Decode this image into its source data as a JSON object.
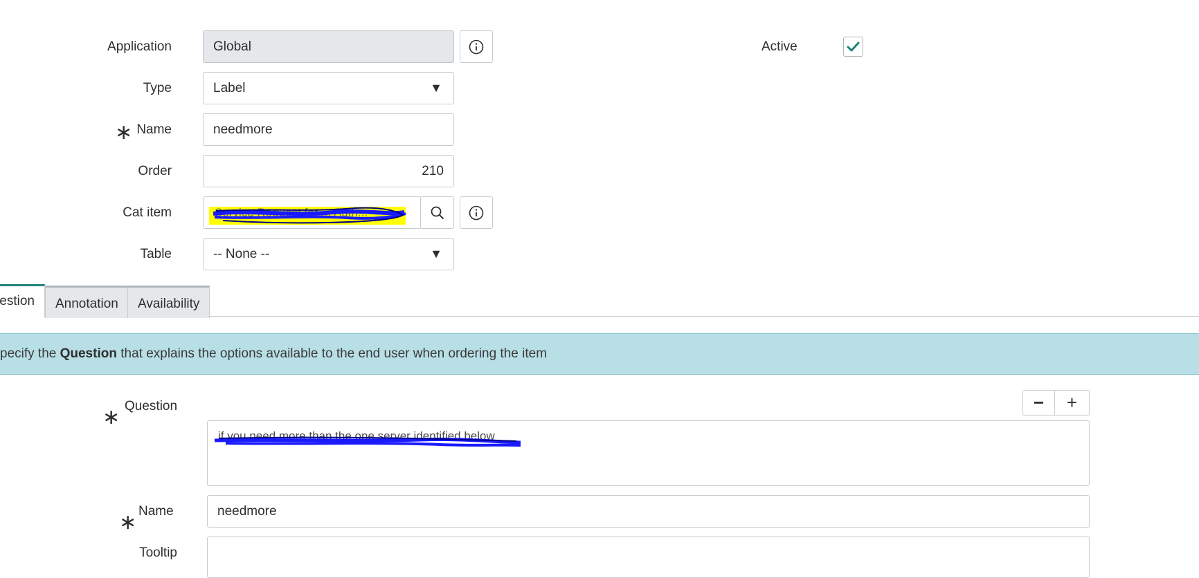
{
  "form": {
    "application": {
      "label": "Application",
      "value": "Global"
    },
    "active": {
      "label": "Active",
      "checked": true
    },
    "type": {
      "label": "Type",
      "value": "Label"
    },
    "name": {
      "label": "Name",
      "value": "needmore"
    },
    "order": {
      "label": "Order",
      "value": "210"
    },
    "cat_item": {
      "label": "Cat item",
      "value": "Service Request for ... Auth..."
    },
    "table": {
      "label": "Table",
      "value": "-- None --"
    }
  },
  "tabs": [
    {
      "label": "estion",
      "active": true
    },
    {
      "label": "Annotation",
      "active": false
    },
    {
      "label": "Availability",
      "active": false
    }
  ],
  "info_banner": {
    "prefix": "pecify the ",
    "bold": "Question",
    "suffix": " that explains the options available to the end user when ordering the item"
  },
  "question_section": {
    "question": {
      "label": "Question",
      "value": "if you need more than the one server identified below"
    },
    "name": {
      "label": "Name",
      "value": "needmore"
    },
    "tooltip": {
      "label": "Tooltip",
      "value": ""
    },
    "minus_label": "−",
    "plus_label": "+"
  },
  "colors": {
    "accent": "#1f8476",
    "banner": "#b8dfe6",
    "redaction_highlight": "#ffff00",
    "redaction_scribble": "#0000ff"
  }
}
